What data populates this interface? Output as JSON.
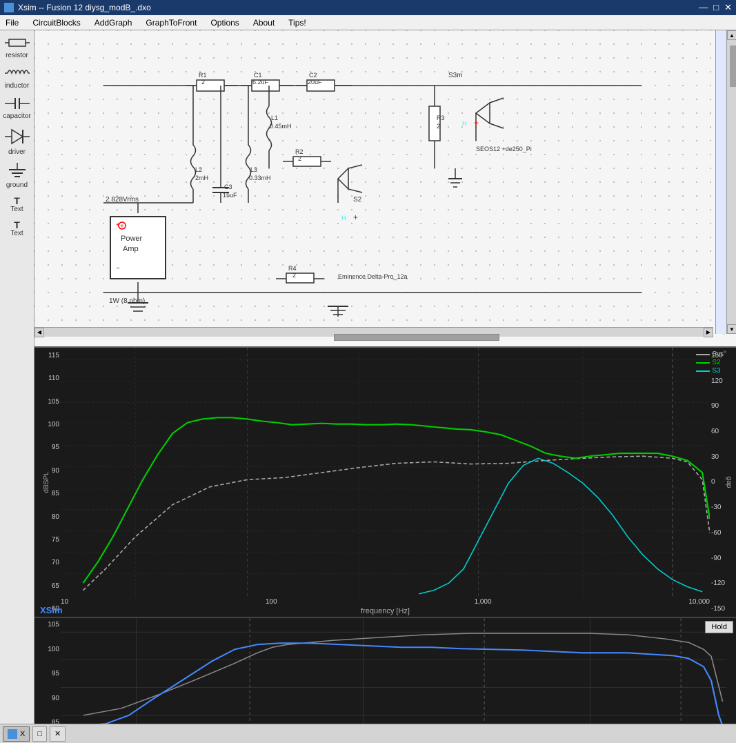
{
  "titlebar": {
    "title": "Xsim -- Fusion 12 diysg_modB_.dxo",
    "icon": "X",
    "min": "—",
    "max": "□",
    "close": "✕"
  },
  "menu": {
    "items": [
      "File",
      "CircuitBlocks",
      "AddGraph",
      "GraphToFront",
      "Options",
      "About",
      "Tips!"
    ]
  },
  "sidebar": {
    "items": [
      {
        "id": "resistor",
        "label": "resistor",
        "symbol": "⊟"
      },
      {
        "id": "inductor",
        "label": "inductor",
        "symbol": "∿"
      },
      {
        "id": "capacitor",
        "label": "capacitor",
        "symbol": "⊣⊢"
      },
      {
        "id": "driver",
        "label": "driver",
        "symbol": "🔊"
      },
      {
        "id": "ground",
        "label": "ground",
        "symbol": "⏚"
      },
      {
        "id": "text1",
        "label": "Text",
        "symbol": "T"
      },
      {
        "id": "text2",
        "label": "Text",
        "symbol": "T"
      }
    ]
  },
  "circuit": {
    "components": {
      "R1": "R1\n2",
      "C1": "C1\n6.2uF",
      "C2": "C2\n20uF",
      "L1": "L1\n0.45mH",
      "R2": "R2\n2",
      "L2": "L2\n2mH",
      "L3": "L3\n0.33mH",
      "R3": "R3\n2",
      "C3": "C3\n15uF",
      "R4": "R4\n2",
      "S2": "S2",
      "S3m": "S3m",
      "powerAmp": "Power\nAmp",
      "voltage": "2.828Vrms",
      "power": "1W (8 ohm)",
      "speaker1": "Eminence Delta-Pro_12a",
      "speaker2": "SEOS12 +de250_Pi"
    }
  },
  "graph": {
    "title": "",
    "xAxisTitle": "frequency [Hz]",
    "yAxisLeftTitle": "dBSPL",
    "yAxisRightTitle": "gap",
    "yLeftValues": [
      "115",
      "110",
      "105",
      "100",
      "95",
      "90",
      "85",
      "80",
      "75",
      "70",
      "65",
      "60"
    ],
    "yRightValues": [
      "150",
      "120",
      "90",
      "60",
      "30",
      "0",
      "-30",
      "-60",
      "-90",
      "-120",
      "-150"
    ],
    "xAxisValues": [
      "10",
      "100",
      "1,000",
      "10,000"
    ],
    "legend": [
      {
        "id": "sys",
        "label": "Sys°",
        "color": "#999",
        "style": "dashed"
      },
      {
        "id": "s2",
        "label": "S2",
        "color": "#00cc00"
      },
      {
        "id": "s3",
        "label": "S3",
        "color": "#00cccc"
      }
    ]
  },
  "miniGraph": {
    "yValues": [
      "105",
      "100",
      "95",
      "90",
      "85"
    ],
    "holdBtn": "Hold"
  },
  "xsimLabel": "XSim",
  "taskbar": {
    "btn1": {
      "label": "X"
    },
    "btn2": {
      "label": ""
    },
    "btn3": {
      "label": "✕"
    }
  }
}
